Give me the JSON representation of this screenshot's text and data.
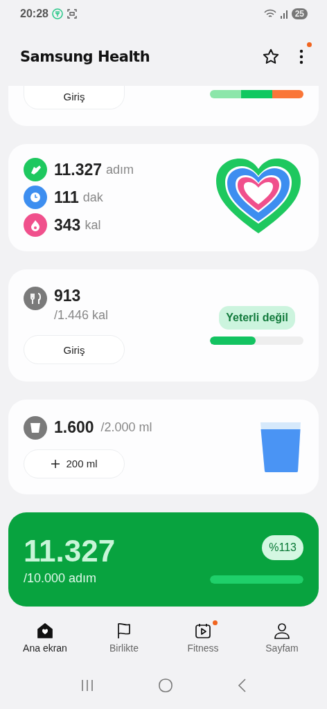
{
  "status_bar": {
    "time": "20:28",
    "battery": "25"
  },
  "header": {
    "title": "Samsung Health",
    "menu_notification": true
  },
  "partial_card": {
    "button": "Giriş",
    "segments": [
      {
        "color": "#8ce6aa"
      },
      {
        "color": "#10c860"
      },
      {
        "color": "#fa7638"
      }
    ]
  },
  "activity_card": {
    "metrics": [
      {
        "value": "11.327",
        "unit": "adım",
        "kind": "steps",
        "color": "#1ec85f"
      },
      {
        "value": "111",
        "unit": "dak",
        "kind": "time",
        "color": "#3d8ef0"
      },
      {
        "value": "343",
        "unit": "kal",
        "kind": "calories",
        "color": "#f0508c"
      }
    ]
  },
  "food_card": {
    "value": "913",
    "goal": "/1.446 kal",
    "button": "Giriş",
    "status": "Yeterli değil",
    "level": 0.49
  },
  "water_card": {
    "value": "1.600",
    "goal": "/2.000 ml",
    "button": "200 ml"
  },
  "steps_card": {
    "value": "11.327",
    "goal": "/10.000 adım",
    "badge": "%113",
    "level": 1
  },
  "bottom_nav": [
    {
      "label": "Ana ekran",
      "kind": "home",
      "selected": true,
      "notification": false
    },
    {
      "label": "Birlikte",
      "kind": "flag",
      "selected": false,
      "notification": false
    },
    {
      "label": "Fitness",
      "kind": "video",
      "selected": false,
      "notification": true
    },
    {
      "label": "Sayfam",
      "kind": "person",
      "selected": false,
      "notification": false
    }
  ]
}
